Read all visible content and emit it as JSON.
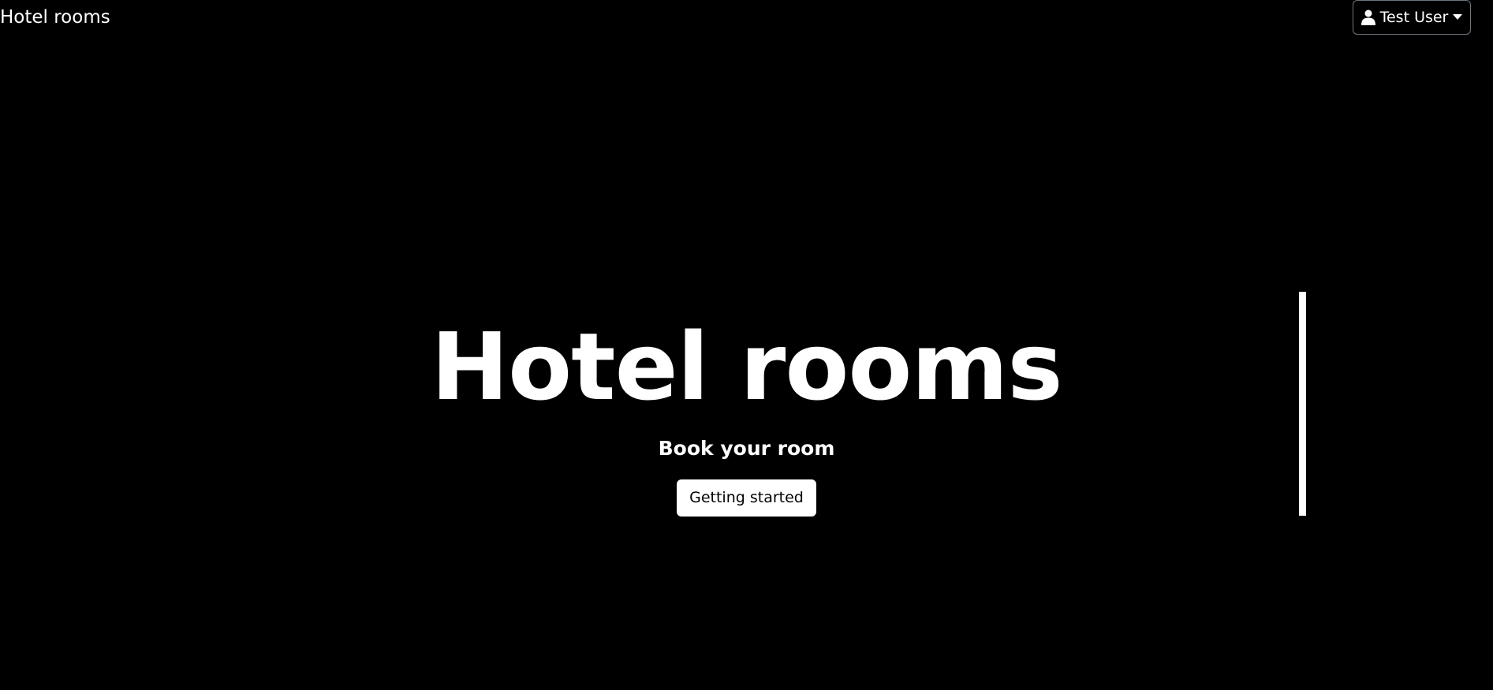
{
  "navbar": {
    "brand": "Hotel rooms",
    "user": {
      "name": "Test User",
      "icon": "person-icon",
      "dropdown_icon": "caret-down-icon"
    }
  },
  "hero": {
    "title": "Hotel rooms",
    "subtitle": "Book your room",
    "cta_label": "Getting started"
  }
}
